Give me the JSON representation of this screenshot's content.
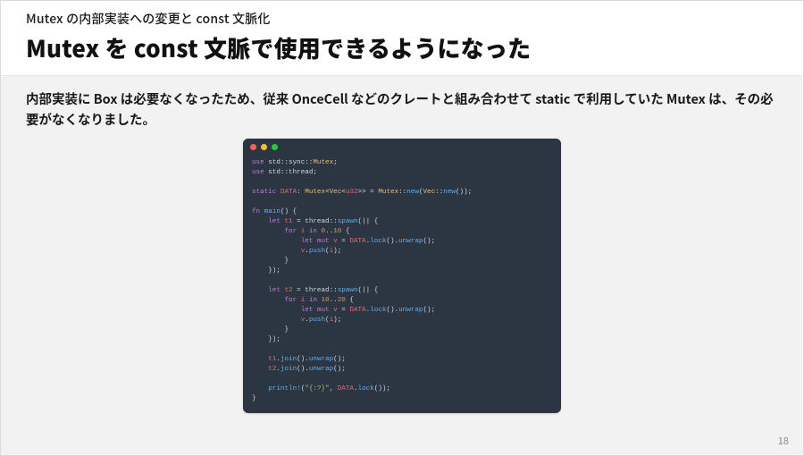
{
  "header": {
    "kicker": "Mutex の内部実装への変更と const 文脈化",
    "title": "Mutex を const 文脈で使用できるようになった"
  },
  "lead": "内部実装に Box は必要なくなったため、従来 OnceCell などのクレートと組み合わせて static で利用していた Mutex は、その必要がなくなりました。",
  "code": {
    "lines": [
      [
        [
          "kw",
          "use "
        ],
        [
          "ns",
          "std::sync::"
        ],
        [
          "ty",
          "Mutex"
        ],
        [
          "punct",
          ";"
        ]
      ],
      [
        [
          "kw",
          "use "
        ],
        [
          "ns",
          "std::"
        ],
        [
          "ident",
          "thread"
        ],
        [
          "punct",
          ";"
        ]
      ],
      [],
      [
        [
          "kw",
          "static "
        ],
        [
          "var",
          "DATA"
        ],
        [
          "punct",
          ": "
        ],
        [
          "ty",
          "Mutex"
        ],
        [
          "punct",
          "<"
        ],
        [
          "ty",
          "Vec"
        ],
        [
          "punct",
          "<"
        ],
        [
          "tyu",
          "u32"
        ],
        [
          "punct",
          ">> = "
        ],
        [
          "ty",
          "Mutex"
        ],
        [
          "punct",
          "::"
        ],
        [
          "fnname",
          "new"
        ],
        [
          "punct",
          "("
        ],
        [
          "ty",
          "Vec"
        ],
        [
          "punct",
          "::"
        ],
        [
          "fnname",
          "new"
        ],
        [
          "punct",
          "());"
        ]
      ],
      [],
      [
        [
          "kw",
          "fn "
        ],
        [
          "fnname",
          "main"
        ],
        [
          "punct",
          "() {"
        ]
      ],
      [
        [
          "punct",
          "    "
        ],
        [
          "kw",
          "let "
        ],
        [
          "var",
          "t1"
        ],
        [
          "punct",
          " = "
        ],
        [
          "ident",
          "thread"
        ],
        [
          "punct",
          "::"
        ],
        [
          "fnname",
          "spawn"
        ],
        [
          "punct",
          "(|| {"
        ]
      ],
      [
        [
          "punct",
          "        "
        ],
        [
          "kw",
          "for "
        ],
        [
          "var",
          "i"
        ],
        [
          "kw",
          " in "
        ],
        [
          "num",
          "0"
        ],
        [
          "punct",
          ".."
        ],
        [
          "num",
          "10"
        ],
        [
          "punct",
          " {"
        ]
      ],
      [
        [
          "punct",
          "            "
        ],
        [
          "kw",
          "let mut "
        ],
        [
          "var",
          "v"
        ],
        [
          "punct",
          " = "
        ],
        [
          "var",
          "DATA"
        ],
        [
          "punct",
          "."
        ],
        [
          "fnname",
          "lock"
        ],
        [
          "punct",
          "()."
        ],
        [
          "fnname",
          "unwrap"
        ],
        [
          "punct",
          "();"
        ]
      ],
      [
        [
          "punct",
          "            "
        ],
        [
          "var",
          "v"
        ],
        [
          "punct",
          "."
        ],
        [
          "fnname",
          "push"
        ],
        [
          "punct",
          "("
        ],
        [
          "var",
          "i"
        ],
        [
          "punct",
          ");"
        ]
      ],
      [
        [
          "punct",
          "        }"
        ]
      ],
      [
        [
          "punct",
          "    });"
        ]
      ],
      [],
      [
        [
          "punct",
          "    "
        ],
        [
          "kw",
          "let "
        ],
        [
          "var",
          "t2"
        ],
        [
          "punct",
          " = "
        ],
        [
          "ident",
          "thread"
        ],
        [
          "punct",
          "::"
        ],
        [
          "fnname",
          "spawn"
        ],
        [
          "punct",
          "(|| {"
        ]
      ],
      [
        [
          "punct",
          "        "
        ],
        [
          "kw",
          "for "
        ],
        [
          "var",
          "i"
        ],
        [
          "kw",
          " in "
        ],
        [
          "num",
          "10"
        ],
        [
          "punct",
          ".."
        ],
        [
          "num",
          "20"
        ],
        [
          "punct",
          " {"
        ]
      ],
      [
        [
          "punct",
          "            "
        ],
        [
          "kw",
          "let mut "
        ],
        [
          "var",
          "v"
        ],
        [
          "punct",
          " = "
        ],
        [
          "var",
          "DATA"
        ],
        [
          "punct",
          "."
        ],
        [
          "fnname",
          "lock"
        ],
        [
          "punct",
          "()."
        ],
        [
          "fnname",
          "unwrap"
        ],
        [
          "punct",
          "();"
        ]
      ],
      [
        [
          "punct",
          "            "
        ],
        [
          "var",
          "v"
        ],
        [
          "punct",
          "."
        ],
        [
          "fnname",
          "push"
        ],
        [
          "punct",
          "("
        ],
        [
          "var",
          "i"
        ],
        [
          "punct",
          ");"
        ]
      ],
      [
        [
          "punct",
          "        }"
        ]
      ],
      [
        [
          "punct",
          "    });"
        ]
      ],
      [],
      [
        [
          "punct",
          "    "
        ],
        [
          "var",
          "t1"
        ],
        [
          "punct",
          "."
        ],
        [
          "fnname",
          "join"
        ],
        [
          "punct",
          "()."
        ],
        [
          "fnname",
          "unwrap"
        ],
        [
          "punct",
          "();"
        ]
      ],
      [
        [
          "punct",
          "    "
        ],
        [
          "var",
          "t2"
        ],
        [
          "punct",
          "."
        ],
        [
          "fnname",
          "join"
        ],
        [
          "punct",
          "()."
        ],
        [
          "fnname",
          "unwrap"
        ],
        [
          "punct",
          "();"
        ]
      ],
      [],
      [
        [
          "punct",
          "    "
        ],
        [
          "fnname",
          "println!"
        ],
        [
          "punct",
          "("
        ],
        [
          "str",
          "\"{:?}\""
        ],
        [
          "punct",
          ", "
        ],
        [
          "var",
          "DATA"
        ],
        [
          "punct",
          "."
        ],
        [
          "fnname",
          "lock"
        ],
        [
          "punct",
          "());"
        ]
      ],
      [
        [
          "punct",
          "}"
        ]
      ]
    ]
  },
  "page_number": "18"
}
